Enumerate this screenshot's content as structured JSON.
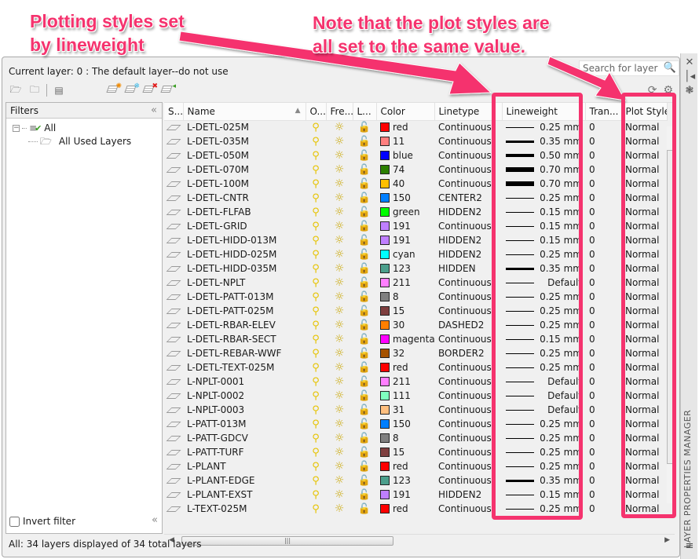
{
  "annotations": {
    "left": [
      "Plotting styles set",
      "by lineweight"
    ],
    "right": [
      "Note that the plot styles are",
      "all set to the same value."
    ],
    "color": "#f5336e"
  },
  "panel": {
    "current_layer": "Current layer: 0 : The default layer--do not use",
    "search_placeholder": "Search for layer",
    "side_title": "LAYER PROPERTIES MANAGER",
    "status": "All: 34 layers displayed of 34 total layers"
  },
  "filters": {
    "header": "Filters",
    "tree": [
      {
        "label": "All"
      },
      {
        "label": "All Used Layers"
      }
    ],
    "invert_label": "Invert filter",
    "invert_checked": false
  },
  "columns": [
    "S...",
    "Name",
    "O...",
    "Fre...",
    "L...",
    "Color",
    "Linetype",
    "Lineweight",
    "Tran...",
    "Plot Style"
  ],
  "rows": [
    {
      "name": "L-DETL-025M",
      "color": "red",
      "hex": "#ff0000",
      "linetype": "Continuous",
      "lineweight": "0.25 mm",
      "lw": 1,
      "trans": "0",
      "plot": "Normal"
    },
    {
      "name": "L-DETL-035M",
      "color": "11",
      "hex": "#ff7f7f",
      "linetype": "Continuous",
      "lineweight": "0.35 mm",
      "lw": 3,
      "trans": "0",
      "plot": "Normal"
    },
    {
      "name": "L-DETL-050M",
      "color": "blue",
      "hex": "#0000ff",
      "linetype": "Continuous",
      "lineweight": "0.50 mm",
      "lw": 4,
      "trans": "0",
      "plot": "Normal"
    },
    {
      "name": "L-DETL-070M",
      "color": "74",
      "hex": "#2b7f00",
      "linetype": "Continuous",
      "lineweight": "0.70 mm",
      "lw": 6,
      "trans": "0",
      "plot": "Normal"
    },
    {
      "name": "L-DETL-100M",
      "color": "40",
      "hex": "#ffbf00",
      "linetype": "Continuous",
      "lineweight": "0.70 mm",
      "lw": 6,
      "trans": "0",
      "plot": "Normal"
    },
    {
      "name": "L-DETL-CNTR",
      "color": "150",
      "hex": "#007fff",
      "linetype": "CENTER2",
      "lineweight": "0.25 mm",
      "lw": 1,
      "trans": "0",
      "plot": "Normal"
    },
    {
      "name": "L-DETL-FLFAB",
      "color": "green",
      "hex": "#00ff00",
      "linetype": "HIDDEN2",
      "lineweight": "0.15 mm",
      "lw": 1,
      "trans": "0",
      "plot": "Normal"
    },
    {
      "name": "L-DETL-GRID",
      "color": "191",
      "hex": "#bf7fff",
      "linetype": "Continuous",
      "lineweight": "0.15 mm",
      "lw": 1,
      "trans": "0",
      "plot": "Normal"
    },
    {
      "name": "L-DETL-HIDD-013M",
      "color": "191",
      "hex": "#bf7fff",
      "linetype": "HIDDEN2",
      "lineweight": "0.15 mm",
      "lw": 1,
      "trans": "0",
      "plot": "Normal"
    },
    {
      "name": "L-DETL-HIDD-025M",
      "color": "cyan",
      "hex": "#00ffff",
      "linetype": "HIDDEN2",
      "lineweight": "0.25 mm",
      "lw": 1,
      "trans": "0",
      "plot": "Normal"
    },
    {
      "name": "L-DETL-HIDD-035M",
      "color": "123",
      "hex": "#4c9f8c",
      "linetype": "HIDDEN",
      "lineweight": "0.35 mm",
      "lw": 3,
      "trans": "0",
      "plot": "Normal"
    },
    {
      "name": "L-DETL-NPLT",
      "color": "211",
      "hex": "#ff7fff",
      "linetype": "Continuous",
      "lineweight": "Default",
      "lw": 1,
      "trans": "0",
      "plot": "Normal"
    },
    {
      "name": "L-DETL-PATT-013M",
      "color": "8",
      "hex": "#808080",
      "linetype": "Continuous",
      "lineweight": "0.25 mm",
      "lw": 1,
      "trans": "0",
      "plot": "Normal"
    },
    {
      "name": "L-DETL-PATT-025M",
      "color": "15",
      "hex": "#7f3f3f",
      "linetype": "Continuous",
      "lineweight": "0.25 mm",
      "lw": 1,
      "trans": "0",
      "plot": "Normal"
    },
    {
      "name": "L-DETL-RBAR-ELEV",
      "color": "30",
      "hex": "#ff7f00",
      "linetype": "DASHED2",
      "lineweight": "0.25 mm",
      "lw": 1,
      "trans": "0",
      "plot": "Normal"
    },
    {
      "name": "L-DETL-RBAR-SECT",
      "color": "magenta",
      "hex": "#ff00ff",
      "linetype": "Continuous",
      "lineweight": "0.15 mm",
      "lw": 1,
      "trans": "0",
      "plot": "Normal"
    },
    {
      "name": "L-DETL-REBAR-WWF",
      "color": "32",
      "hex": "#a55200",
      "linetype": "BORDER2",
      "lineweight": "0.25 mm",
      "lw": 1,
      "trans": "0",
      "plot": "Normal"
    },
    {
      "name": "L-DETL-TEXT-025M",
      "color": "red",
      "hex": "#ff0000",
      "linetype": "Continuous",
      "lineweight": "0.25 mm",
      "lw": 1,
      "trans": "0",
      "plot": "Normal"
    },
    {
      "name": "L-NPLT-0001",
      "color": "211",
      "hex": "#ff7fff",
      "linetype": "Continuous",
      "lineweight": "Default",
      "lw": 1,
      "trans": "0",
      "plot": "Normal"
    },
    {
      "name": "L-NPLT-0002",
      "color": "111",
      "hex": "#7fffbf",
      "linetype": "Continuous",
      "lineweight": "Default",
      "lw": 1,
      "trans": "0",
      "plot": "Normal"
    },
    {
      "name": "L-NPLT-0003",
      "color": "31",
      "hex": "#ffbf7f",
      "linetype": "Continuous",
      "lineweight": "Default",
      "lw": 1,
      "trans": "0",
      "plot": "Normal"
    },
    {
      "name": "L-PATT-013M",
      "color": "150",
      "hex": "#007fff",
      "linetype": "Continuous",
      "lineweight": "0.25 mm",
      "lw": 1,
      "trans": "0",
      "plot": "Normal"
    },
    {
      "name": "L-PATT-GDCV",
      "color": "8",
      "hex": "#808080",
      "linetype": "Continuous",
      "lineweight": "0.25 mm",
      "lw": 1,
      "trans": "0",
      "plot": "Normal"
    },
    {
      "name": "L-PATT-TURF",
      "color": "15",
      "hex": "#7f3f3f",
      "linetype": "Continuous",
      "lineweight": "0.25 mm",
      "lw": 1,
      "trans": "0",
      "plot": "Normal"
    },
    {
      "name": "L-PLANT",
      "color": "red",
      "hex": "#ff0000",
      "linetype": "Continuous",
      "lineweight": "0.25 mm",
      "lw": 1,
      "trans": "0",
      "plot": "Normal"
    },
    {
      "name": "L-PLANT-EDGE",
      "color": "123",
      "hex": "#4c9f8c",
      "linetype": "Continuous",
      "lineweight": "0.35 mm",
      "lw": 3,
      "trans": "0",
      "plot": "Normal"
    },
    {
      "name": "L-PLANT-EXST",
      "color": "191",
      "hex": "#bf7fff",
      "linetype": "HIDDEN2",
      "lineweight": "0.15 mm",
      "lw": 1,
      "trans": "0",
      "plot": "Normal"
    },
    {
      "name": "L-TEXT-025M",
      "color": "red",
      "hex": "#ff0000",
      "linetype": "Continuous",
      "lineweight": "0.25 mm",
      "lw": 1,
      "trans": "0",
      "plot": "Normal"
    }
  ],
  "icons": {
    "status": "layer-status-icon",
    "on": "lightbulb-icon",
    "freeze": "sun-icon",
    "lock": "unlocked-padlock-icon"
  }
}
